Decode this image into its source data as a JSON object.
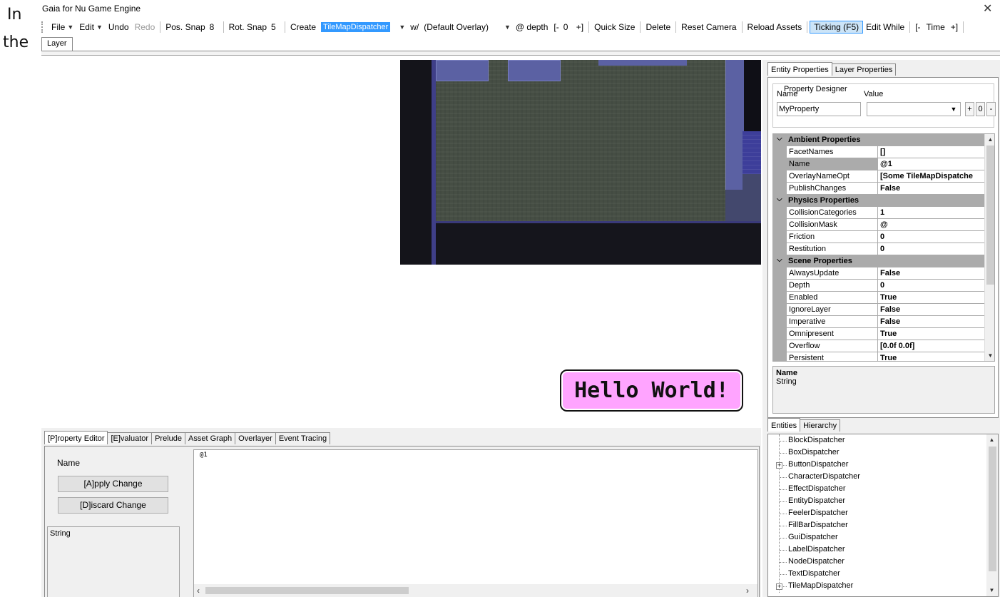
{
  "margin_text": {
    "line1": "In",
    "line2": "the"
  },
  "window": {
    "title": "Gaia for Nu Game Engine",
    "close_glyph": "✕"
  },
  "toolbar": {
    "file": "File",
    "edit": "Edit",
    "undo": "Undo",
    "redo": "Redo",
    "pos_snap_label": "Pos. Snap",
    "pos_snap_value": "8",
    "rot_snap_label": "Rot. Snap",
    "rot_snap_value": "5",
    "create": "Create",
    "dispatcher_selected": "TileMapDispatcher",
    "with_label": "w/",
    "overlay_selected": "(Default Overlay)",
    "depth_label": "@ depth",
    "depth_minus": "[-",
    "depth_value": "0",
    "depth_plus": "+]",
    "quick_size": "Quick Size",
    "delete": "Delete",
    "reset_camera": "Reset Camera",
    "reload_assets": "Reload Assets",
    "ticking": "Ticking (F5)",
    "edit_while": "Edit While",
    "time_minus": "[-",
    "time_label": "Time",
    "time_plus": "+]"
  },
  "layer_tab": "Layer",
  "viewport": {
    "hello_text": "Hello World!"
  },
  "entity_properties": {
    "tabs": [
      "Entity Properties",
      "Layer Properties"
    ],
    "designer": {
      "legend": "Property Designer",
      "name_label": "Name",
      "value_label": "Value",
      "name_value": "MyProperty",
      "value_value": "",
      "btn_plus": "+",
      "btn_zero": "0",
      "btn_minus": "-"
    },
    "grid": [
      {
        "type": "category",
        "label": "Ambient Properties"
      },
      {
        "type": "prop",
        "name": "FacetNames",
        "value": "[]"
      },
      {
        "type": "prop",
        "name": "Name",
        "value": "@1",
        "selected": true
      },
      {
        "type": "prop",
        "name": "OverlayNameOpt",
        "value": "[Some TileMapDispatche"
      },
      {
        "type": "prop",
        "name": "PublishChanges",
        "value": "False"
      },
      {
        "type": "category",
        "label": "Physics Properties"
      },
      {
        "type": "prop",
        "name": "CollisionCategories",
        "value": "1"
      },
      {
        "type": "prop",
        "name": "CollisionMask",
        "value": "@"
      },
      {
        "type": "prop",
        "name": "Friction",
        "value": "0"
      },
      {
        "type": "prop",
        "name": "Restitution",
        "value": "0"
      },
      {
        "type": "category",
        "label": "Scene Properties"
      },
      {
        "type": "prop",
        "name": "AlwaysUpdate",
        "value": "False"
      },
      {
        "type": "prop",
        "name": "Depth",
        "value": "0"
      },
      {
        "type": "prop",
        "name": "Enabled",
        "value": "True"
      },
      {
        "type": "prop",
        "name": "IgnoreLayer",
        "value": "False"
      },
      {
        "type": "prop",
        "name": "Imperative",
        "value": "False"
      },
      {
        "type": "prop",
        "name": "Omnipresent",
        "value": "True"
      },
      {
        "type": "prop",
        "name": "Overflow",
        "value": "[0.0f 0.0f]"
      },
      {
        "type": "prop",
        "name": "Persistent",
        "value": "True"
      }
    ],
    "description": {
      "name": "Name",
      "type": "String"
    }
  },
  "entities": {
    "tabs": [
      "Entities",
      "Hierarchy"
    ],
    "items": [
      {
        "label": "BlockDispatcher",
        "expandable": false
      },
      {
        "label": "BoxDispatcher",
        "expandable": false
      },
      {
        "label": "ButtonDispatcher",
        "expandable": true
      },
      {
        "label": "CharacterDispatcher",
        "expandable": false
      },
      {
        "label": "EffectDispatcher",
        "expandable": false
      },
      {
        "label": "EntityDispatcher",
        "expandable": false
      },
      {
        "label": "FeelerDispatcher",
        "expandable": false
      },
      {
        "label": "FillBarDispatcher",
        "expandable": false
      },
      {
        "label": "GuiDispatcher",
        "expandable": false
      },
      {
        "label": "LabelDispatcher",
        "expandable": false
      },
      {
        "label": "NodeDispatcher",
        "expandable": false
      },
      {
        "label": "TextDispatcher",
        "expandable": false
      },
      {
        "label": "TileMapDispatcher",
        "expandable": true
      }
    ]
  },
  "bottom_panel": {
    "tabs": [
      "[P]roperty Editor",
      "[E]valuator",
      "Prelude",
      "Asset Graph",
      "Overlayer",
      "Event Tracing"
    ],
    "name_label": "Name",
    "apply_button": "[A]pply Change",
    "discard_button": "[D]iscard Change",
    "type_text": "String",
    "editor_text": "@1"
  }
}
